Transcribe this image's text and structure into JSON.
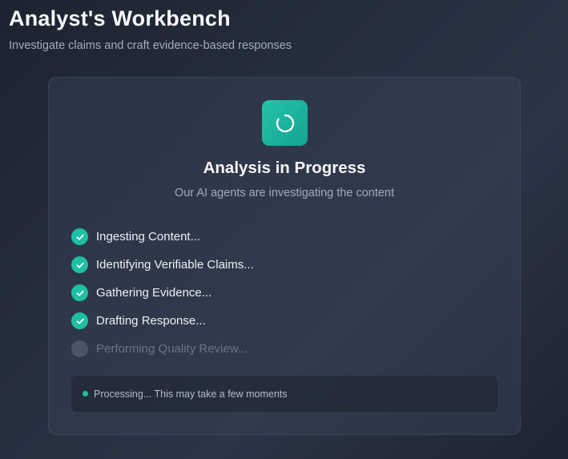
{
  "header": {
    "title": "Analyst's Workbench",
    "subtitle": "Investigate claims and craft evidence-based responses"
  },
  "card": {
    "icon": "loading-spinner-icon",
    "title": "Analysis in Progress",
    "subtitle": "Our AI agents are investigating the content",
    "steps": [
      {
        "label": "Ingesting Content...",
        "status": "complete"
      },
      {
        "label": "Identifying Verifiable Claims...",
        "status": "complete"
      },
      {
        "label": "Gathering Evidence...",
        "status": "complete"
      },
      {
        "label": "Drafting Response...",
        "status": "complete"
      },
      {
        "label": "Performing Quality Review...",
        "status": "pending"
      }
    ],
    "status_text": "Processing... This may take a few moments"
  },
  "colors": {
    "accent": "#1fbfa4",
    "pending": "#4a5566",
    "background": "#262f3e"
  }
}
